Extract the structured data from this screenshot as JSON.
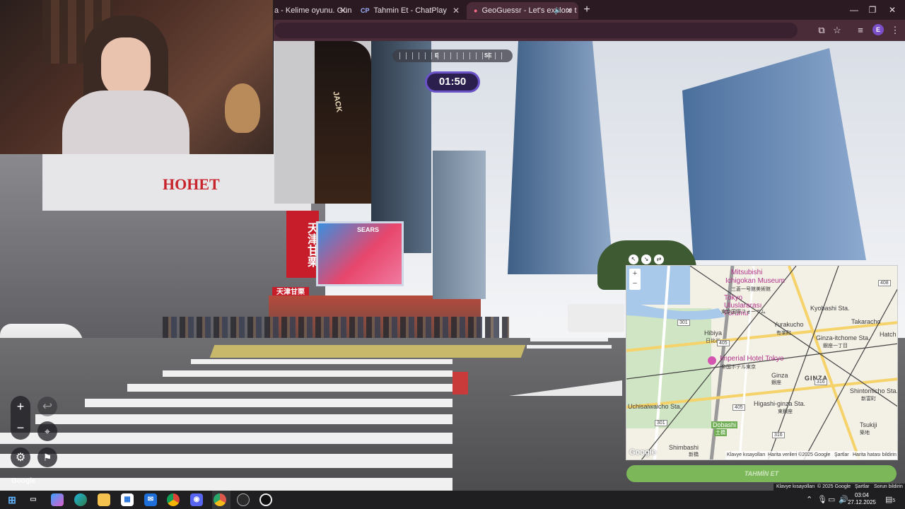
{
  "browser": {
    "tabs": [
      {
        "label": "a - Kelime oyunu. Günlük",
        "favicon": ""
      },
      {
        "label": "Tahmin Et - ChatPlay",
        "favicon": "CP"
      },
      {
        "label": "GeoGuessr - Let's explore t",
        "favicon": "map-pin-icon",
        "active": true
      }
    ],
    "new_tab": "+",
    "profile_initial": "E"
  },
  "game": {
    "compass": {
      "left": "E",
      "right": "SE"
    },
    "timer": "01:50",
    "zoom_in": "+",
    "zoom_out": "−",
    "undo": "↩",
    "watermark": "Google",
    "guess_button": "TAHMİN ET",
    "street_footer": {
      "shortcuts": "Klavye kısayolları",
      "copyright": "© 2025 Google",
      "terms": "Şartlar",
      "report": "Sorun bildirin"
    }
  },
  "scene_signs": {
    "store_sign": "HOHET",
    "vertical_sign": "天津甘栗",
    "shop_sign": "天津甘栗",
    "screen_brand": "SEARS",
    "bottle_brand": "JACK"
  },
  "map": {
    "zoom_in": "+",
    "zoom_out": "−",
    "labels": {
      "mitsubishi": "Mitsubishi",
      "ichigokan": "Ichigokan Museum",
      "ichigokan_jp": "三菱一号館美術館",
      "forum": "Tokyo Uluslararası Forumu",
      "forum_jp": "東京国際フォーラム",
      "kyobashi": "Kyobashi Sta.",
      "takaracho": "Takaracho",
      "yurakucho": "Yurakucho",
      "yurakucho_jp": "有楽町",
      "hibiya": "Hibiya",
      "hibiya_jp": "日比谷",
      "ginza_itchome": "Ginza-itchome Sta.",
      "ginza_itchome_jp": "銀座一丁目",
      "imperial": "Imperial Hotel Tokyo",
      "imperial_jp": "帝国ホテル東京",
      "ginza": "GINZA",
      "ginza_small": "Ginza",
      "ginza_jp": "銀座",
      "shintomicho": "Shintomicho Sta.",
      "shintomicho_jp": "新富町",
      "uchisaiwaicho": "Uchisaiwaicho Sta.",
      "higashi_ginza": "Higashi-ginza Sta.",
      "higashi_ginza_jp": "東銀座",
      "dobashi": "Dobashi",
      "dobashi_jp": "土橋",
      "shimbashi": "Shimbashi",
      "shimbashi_jp": "新橋",
      "tsukiji": "Tsukiji",
      "tsukiji_jp": "築地",
      "hatch": "Hatch",
      "google": "Google"
    },
    "road_numbers": [
      "408",
      "301",
      "405",
      "316",
      "316",
      "405",
      "301"
    ],
    "footer": {
      "shortcuts": "Klavye kısayolları",
      "data": "Harita verileri ©2025 Google",
      "terms": "Şartlar",
      "report": "Harita hatası bildirin"
    }
  },
  "taskbar": {
    "time": "03:04",
    "date": "27.12.2025",
    "notifications": "5"
  },
  "colors": {
    "accent_purple": "#6a52c9",
    "timer_bg": "#2a1f4d",
    "guess_green": "#7cb75a",
    "browser_frame": "#4a2c38"
  }
}
